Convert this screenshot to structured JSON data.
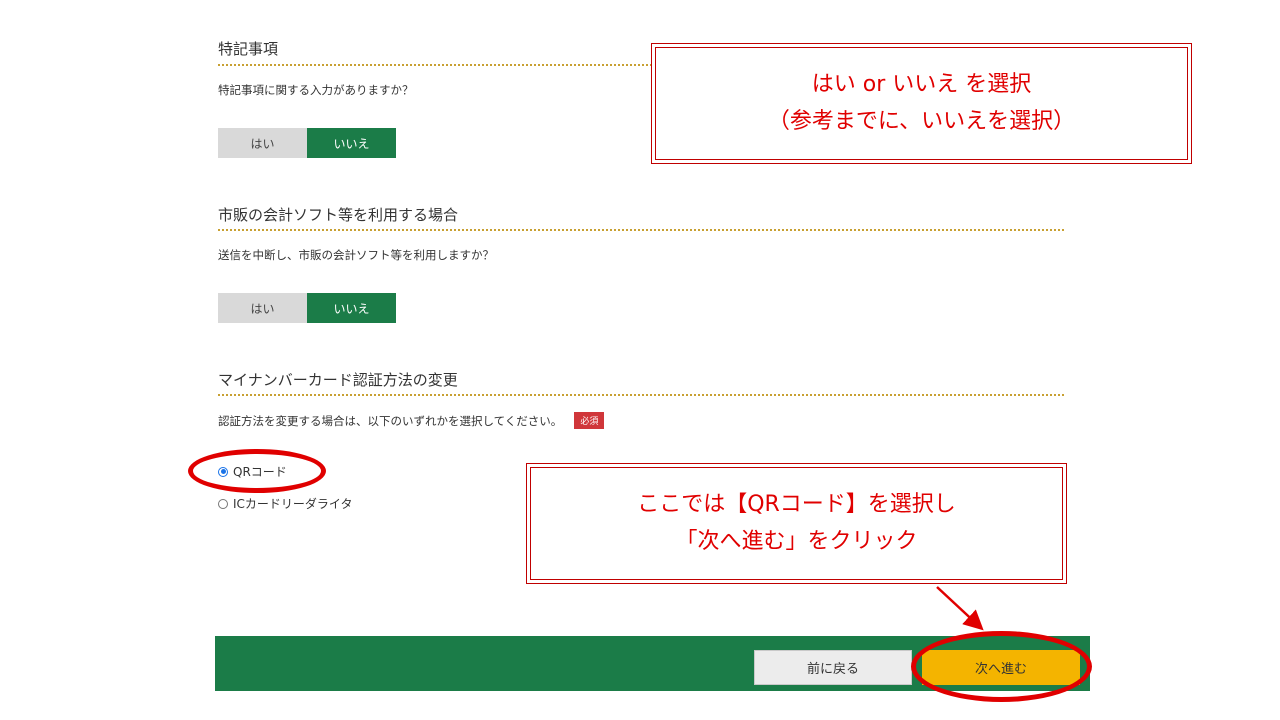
{
  "sections": [
    {
      "title": "特記事項",
      "question": "特記事項に関する入力がありますか？",
      "yes_label": "はい",
      "no_label": "いいえ",
      "selected": "いいえ"
    },
    {
      "title": "市販の会計ソフト等を利用する場合",
      "question": "送信を中断し、市販の会計ソフト等を利用しますか？",
      "yes_label": "はい",
      "no_label": "いいえ",
      "selected": "いいえ"
    },
    {
      "title": "マイナンバーカード認証方法の変更",
      "question": "認証方法を変更する場合は、以下のいずれかを選択してください。",
      "required_badge": "必須",
      "options": [
        {
          "label": "QRコード",
          "checked": true
        },
        {
          "label": "ICカードリーダライタ",
          "checked": false
        }
      ]
    }
  ],
  "annotations": {
    "top_callout": {
      "line1": "はい or いいえ を選択",
      "line2": "（参考までに、いいえを選択）"
    },
    "bottom_callout": {
      "line1": "ここでは【QRコード】を選択し",
      "line2": "「次へ進む」をクリック"
    },
    "color": "#e00000"
  },
  "footer": {
    "back_label": "前に戻る",
    "next_label": "次へ進む",
    "bar_color": "#1b7c48",
    "next_color": "#f4b400"
  },
  "colors": {
    "toggle_selected": "#1b7c48",
    "toggle_unselected": "#d9d9d9",
    "divider": "#c8a032",
    "required": "#d0363a"
  }
}
